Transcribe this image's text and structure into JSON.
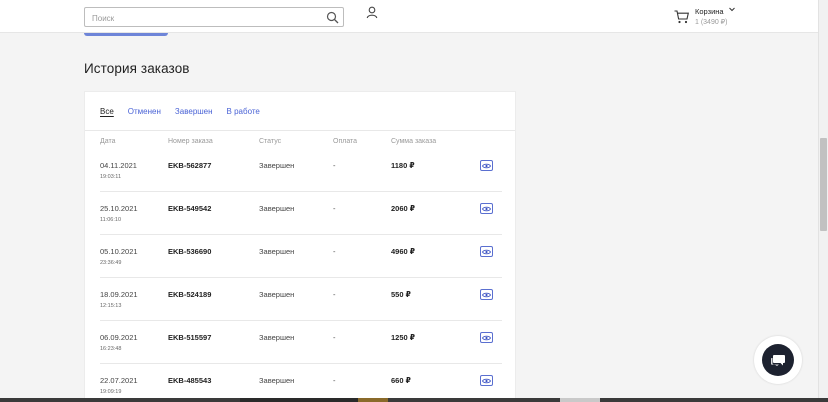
{
  "header": {
    "search_placeholder": "Поиск",
    "cart_label": "Корзина",
    "cart_sum": "1 (3490 ₽)"
  },
  "page": {
    "title": "История заказов"
  },
  "tabs": [
    {
      "label": "Все",
      "active": true
    },
    {
      "label": "Отменен",
      "active": false
    },
    {
      "label": "Завершен",
      "active": false
    },
    {
      "label": "В работе",
      "active": false
    }
  ],
  "table": {
    "headers": {
      "date": "Дата",
      "number": "Номер заказа",
      "status": "Статус",
      "payment": "Оплата",
      "sum": "Сумма заказа"
    },
    "rows": [
      {
        "date": "04.11.2021",
        "time": "19:03:11",
        "number": "EKB-562877",
        "status": "Завершен",
        "payment": "-",
        "sum": "1180 ₽"
      },
      {
        "date": "25.10.2021",
        "time": "11:06:10",
        "number": "EKB-549542",
        "status": "Завершен",
        "payment": "-",
        "sum": "2060 ₽"
      },
      {
        "date": "05.10.2021",
        "time": "23:36:49",
        "number": "EKB-536690",
        "status": "Завершен",
        "payment": "-",
        "sum": "4960 ₽"
      },
      {
        "date": "18.09.2021",
        "time": "12:15:13",
        "number": "EKB-524189",
        "status": "Завершен",
        "payment": "-",
        "sum": "550 ₽"
      },
      {
        "date": "06.09.2021",
        "time": "16:23:48",
        "number": "EKB-515597",
        "status": "Завершен",
        "payment": "-",
        "sum": "1250 ₽"
      },
      {
        "date": "22.07.2021",
        "time": "19:09:19",
        "number": "EKB-485543",
        "status": "Завершен",
        "payment": "-",
        "sum": "660 ₽"
      }
    ]
  },
  "icons": {
    "search": "search-icon",
    "user": "user-icon",
    "cart": "cart-icon",
    "view": "eye-icon",
    "chat": "chat-icon"
  },
  "colors": {
    "accent": "#4a63d6",
    "chat_bg": "#1d2230"
  }
}
